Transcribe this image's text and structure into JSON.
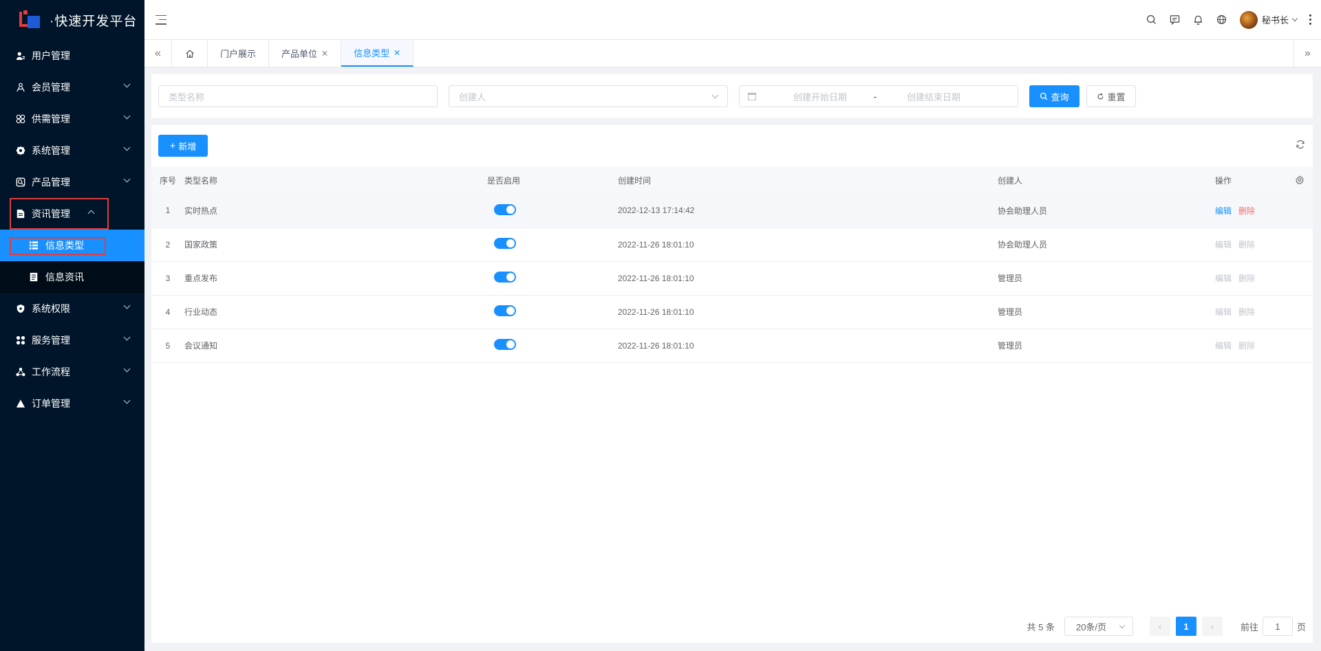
{
  "app": {
    "title": "·快速开发平台"
  },
  "sidebar": {
    "items": [
      {
        "label": "用户管理",
        "icon": "user-icon",
        "has_children": false
      },
      {
        "label": "会员管理",
        "icon": "member-icon",
        "has_children": true
      },
      {
        "label": "供需管理",
        "icon": "supply-icon",
        "has_children": true
      },
      {
        "label": "系统管理",
        "icon": "gear-icon",
        "has_children": true
      },
      {
        "label": "产品管理",
        "icon": "product-icon",
        "has_children": true
      },
      {
        "label": "资讯管理",
        "icon": "document-icon",
        "has_children": true,
        "expanded": true,
        "children": [
          {
            "label": "信息类型",
            "icon": "list-icon",
            "active": true
          },
          {
            "label": "信息资讯",
            "icon": "file-icon",
            "active": false
          }
        ]
      },
      {
        "label": "系统权限",
        "icon": "shield-icon",
        "has_children": true
      },
      {
        "label": "服务管理",
        "icon": "service-icon",
        "has_children": true
      },
      {
        "label": "工作流程",
        "icon": "workflow-icon",
        "has_children": true
      },
      {
        "label": "订单管理",
        "icon": "triangle-icon",
        "has_children": true
      }
    ]
  },
  "header": {
    "user_name": "秘书长",
    "icons": [
      "search-icon",
      "message-icon",
      "bell-icon",
      "globe-icon"
    ]
  },
  "tabs": [
    {
      "label": "门户展示",
      "closable": false
    },
    {
      "label": "产品单位",
      "closable": true
    },
    {
      "label": "信息类型",
      "closable": true,
      "active": true
    }
  ],
  "filters": {
    "name_placeholder": "类型名称",
    "creator_placeholder": "创建人",
    "start_date_placeholder": "创建开始日期",
    "date_separator": "-",
    "end_date_placeholder": "创建结束日期",
    "query_label": "查询",
    "reset_label": "重置"
  },
  "toolbar": {
    "add_label": "新增"
  },
  "table": {
    "columns": [
      "序号",
      "类型名称",
      "是否启用",
      "创建时间",
      "创建人",
      "操作"
    ],
    "rows": [
      {
        "index": "1",
        "name": "实时热点",
        "enabled": true,
        "created": "2022-12-13 17:14:42",
        "creator": "协会助理人员",
        "edit": "编辑",
        "delete": "删除",
        "ops_enabled": true
      },
      {
        "index": "2",
        "name": "国家政策",
        "enabled": true,
        "created": "2022-11-26 18:01:10",
        "creator": "协会助理人员",
        "edit": "编辑",
        "delete": "删除",
        "ops_enabled": false
      },
      {
        "index": "3",
        "name": "重点发布",
        "enabled": true,
        "created": "2022-11-26 18:01:10",
        "creator": "管理员",
        "edit": "编辑",
        "delete": "删除",
        "ops_enabled": false
      },
      {
        "index": "4",
        "name": "行业动态",
        "enabled": true,
        "created": "2022-11-26 18:01:10",
        "creator": "管理员",
        "edit": "编辑",
        "delete": "删除",
        "ops_enabled": false
      },
      {
        "index": "5",
        "name": "会议通知",
        "enabled": true,
        "created": "2022-11-26 18:01:10",
        "creator": "管理员",
        "edit": "编辑",
        "delete": "删除",
        "ops_enabled": false
      }
    ]
  },
  "pagination": {
    "total_text": "共 5 条",
    "page_size": "20条/页",
    "current_page": "1",
    "goto_prefix": "前往",
    "goto_value": "1",
    "goto_suffix": "页"
  },
  "colors": {
    "primary": "#1890ff",
    "sidebar_bg": "#001529",
    "danger": "#f56c6c",
    "highlight_box": "#e43c3c"
  }
}
